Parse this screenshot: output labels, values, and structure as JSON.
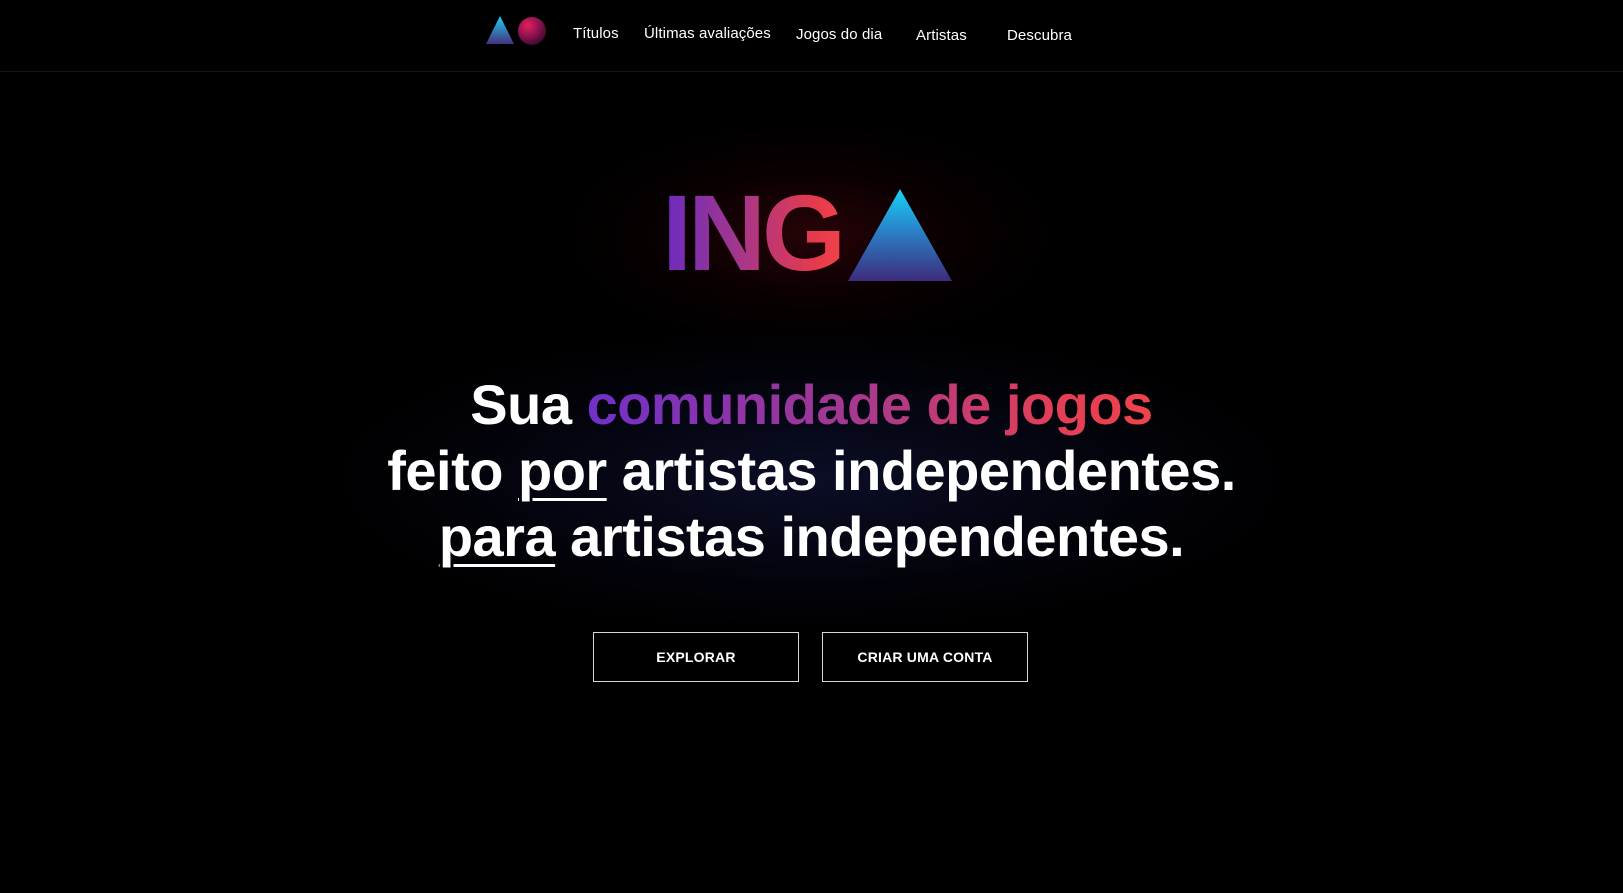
{
  "nav": {
    "items": [
      {
        "label": "Títulos"
      },
      {
        "label": "Últimas avaliações"
      },
      {
        "label": "Jogos do dia"
      },
      {
        "label": "Artistas"
      },
      {
        "label": "Descubra"
      }
    ]
  },
  "brand": {
    "text": "ING"
  },
  "hero": {
    "line1_prefix": "Sua ",
    "line1_highlight": "comunidade de jogos",
    "line2_underlined": "por",
    "line2_prefix": "feito ",
    "line2_suffix": " artistas independentes.",
    "line3_underlined": "para",
    "line3_suffix": " artistas independentes."
  },
  "buttons": {
    "explore_label": "EXPLORAR",
    "signup_label": "CRIAR UMA CONTA"
  },
  "colors": {
    "background": "#000000",
    "gradient_start": "#6a2bc0",
    "gradient_end": "#f0434a",
    "triangle_top": "#19c9f0",
    "triangle_bottom": "#3b2a7a"
  }
}
